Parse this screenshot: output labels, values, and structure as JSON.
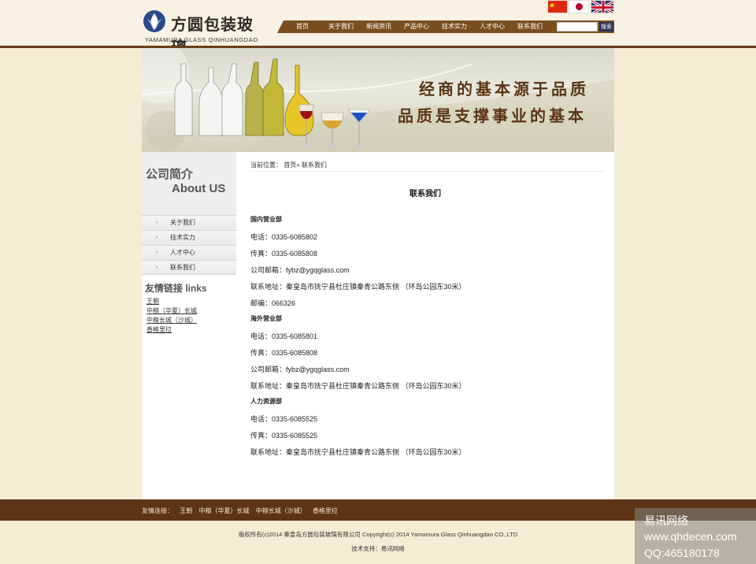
{
  "logo": {
    "cn": "方圆包装玻璃",
    "en": "YAMAMURA GLASS QINHUANGDAO"
  },
  "flags": [
    "china-flag",
    "japan-flag",
    "uk-flag"
  ],
  "nav": {
    "items": [
      "首页",
      "关于我们",
      "新闻资讯",
      "产品中心",
      "技术实力",
      "人才中心",
      "联系我们"
    ],
    "search_button": "搜索",
    "search_value": ""
  },
  "banner": {
    "line1": "经商的基本源于品质",
    "line2": "品质是支撑事业的基本"
  },
  "sidebar": {
    "title_cn": "公司简介",
    "title_en": "About US",
    "menu": [
      "关于我们",
      "技术实力",
      "人才中心",
      "联系我们"
    ],
    "links_title": "友情链接 links",
    "links": [
      "王朝",
      "中粮（华夏）长城",
      "中粮长城（沙城）",
      "香格里拉"
    ]
  },
  "main": {
    "breadcrumb": "当前位置： 首页» 联系我们",
    "title": "联系我们",
    "lines": [
      {
        "text": "国内营业部",
        "bold": true
      },
      {
        "text": "电话：0335-6085802",
        "bold": false
      },
      {
        "text": "传真：0335-6085808",
        "bold": false
      },
      {
        "text": "公司邮箱：fybz@ygqglass.com",
        "bold": false
      },
      {
        "text": "联系地址：秦皇岛市抚宁县杜庄镇秦青公路东侧 （环岛公园东30米）",
        "bold": false
      },
      {
        "text": "邮编：066326",
        "bold": false
      },
      {
        "text": "海外营业部",
        "bold": true
      },
      {
        "text": "电话：0335-6085801",
        "bold": false
      },
      {
        "text": "传真：0335-6085808",
        "bold": false
      },
      {
        "text": "公司邮箱：fybz@ygqglass.com",
        "bold": false
      },
      {
        "text": "联系地址：秦皇岛市抚宁县杜庄镇秦青公路东侧 （环岛公园东30米）",
        "bold": false
      },
      {
        "text": "人力资源部",
        "bold": true
      },
      {
        "text": "电话：0335-6085525",
        "bold": false
      },
      {
        "text": "传真：0335-6085525",
        "bold": false
      },
      {
        "text": "联系地址：秦皇岛市抚宁县杜庄镇秦青公路东侧 （环岛公园东30米）",
        "bold": false
      }
    ]
  },
  "footer": {
    "links_label": "友情连接：",
    "links": [
      "王朝",
      "中粮（华夏）长城",
      "中粮长城（沙城）",
      "香格里拉"
    ],
    "copyright": "版权所有(c)2014 秦皇岛方圆包装玻璃有限公司  Copyright(c) 2014 Yamamura Glass Qinhuangdao CO.,LTD",
    "support": "技术支持：易讯网络"
  },
  "watermark": [
    "易讯网络",
    "www.qhdecen.com",
    "QQ:465180178"
  ]
}
